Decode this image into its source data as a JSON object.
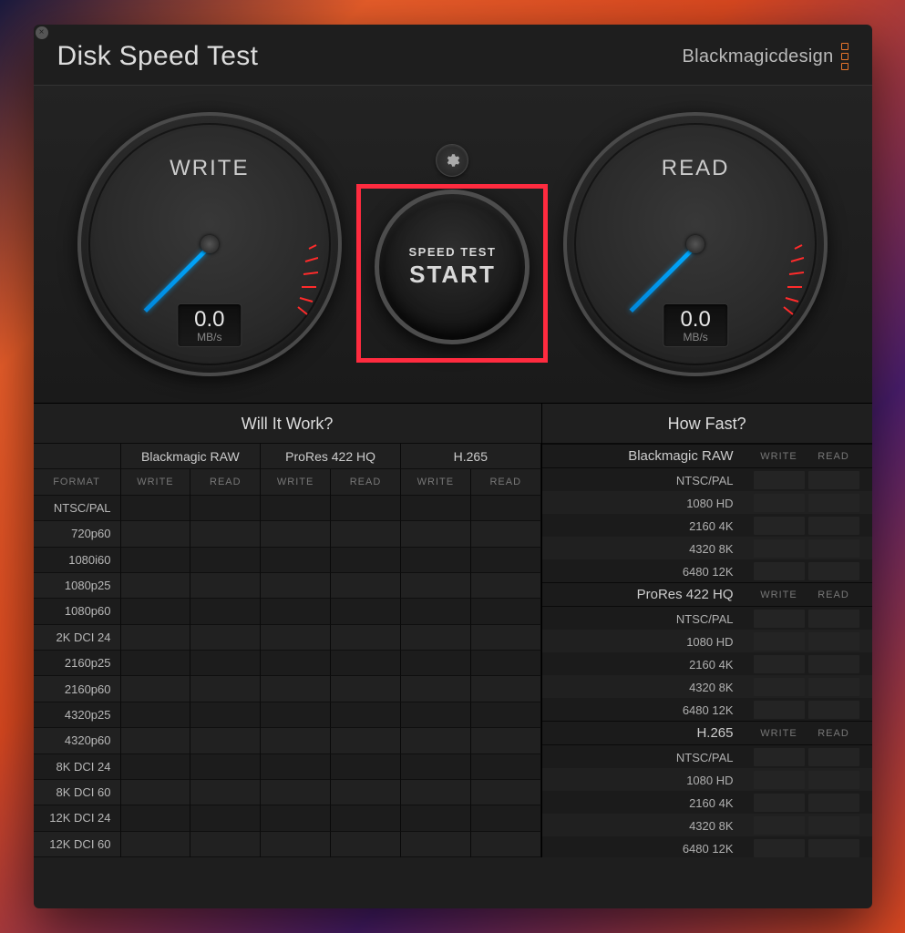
{
  "header": {
    "title": "Disk Speed Test",
    "brand": "Blackmagicdesign"
  },
  "gauges": {
    "write": {
      "label": "WRITE",
      "value": "0.0",
      "unit": "MB/s"
    },
    "read": {
      "label": "READ",
      "value": "0.0",
      "unit": "MB/s"
    }
  },
  "start_button": {
    "line1": "SPEED TEST",
    "line2": "START"
  },
  "will_it_work": {
    "title": "Will It Work?",
    "format_header": "FORMAT",
    "write_header": "WRITE",
    "read_header": "READ",
    "codecs": [
      "Blackmagic RAW",
      "ProRes 422 HQ",
      "H.265"
    ],
    "formats": [
      "NTSC/PAL",
      "720p60",
      "1080i60",
      "1080p25",
      "1080p60",
      "2K DCI 24",
      "2160p25",
      "2160p60",
      "4320p25",
      "4320p60",
      "8K DCI 24",
      "8K DCI 60",
      "12K DCI 24",
      "12K DCI 60"
    ]
  },
  "how_fast": {
    "title": "How Fast?",
    "write_header": "WRITE",
    "read_header": "READ",
    "groups": [
      {
        "name": "Blackmagic RAW",
        "rows": [
          "NTSC/PAL",
          "1080 HD",
          "2160 4K",
          "4320 8K",
          "6480 12K"
        ]
      },
      {
        "name": "ProRes 422 HQ",
        "rows": [
          "NTSC/PAL",
          "1080 HD",
          "2160 4K",
          "4320 8K",
          "6480 12K"
        ]
      },
      {
        "name": "H.265",
        "rows": [
          "NTSC/PAL",
          "1080 HD",
          "2160 4K",
          "4320 8K",
          "6480 12K"
        ]
      }
    ]
  }
}
